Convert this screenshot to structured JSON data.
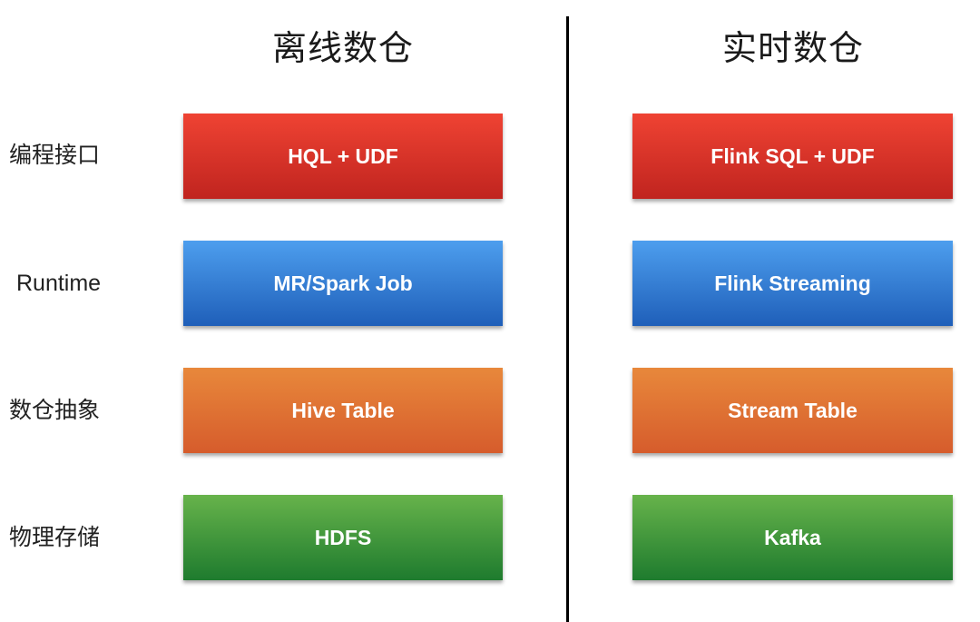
{
  "columns": {
    "offline": {
      "title": "离线数仓"
    },
    "realtime": {
      "title": "实时数仓"
    }
  },
  "rows": [
    {
      "label": "编程接口",
      "offline": "HQL + UDF",
      "realtime": "Flink SQL + UDF",
      "color": "#e0352a"
    },
    {
      "label": "Runtime",
      "offline": "MR/Spark Job",
      "realtime": "Flink Streaming",
      "color": "#3a84dc"
    },
    {
      "label": "数仓抽象",
      "offline": "Hive Table",
      "realtime": "Stream Table",
      "color": "#e07535"
    },
    {
      "label": "物理存储",
      "offline": "HDFS",
      "realtime": "Kafka",
      "color": "#3f9a3c"
    }
  ]
}
